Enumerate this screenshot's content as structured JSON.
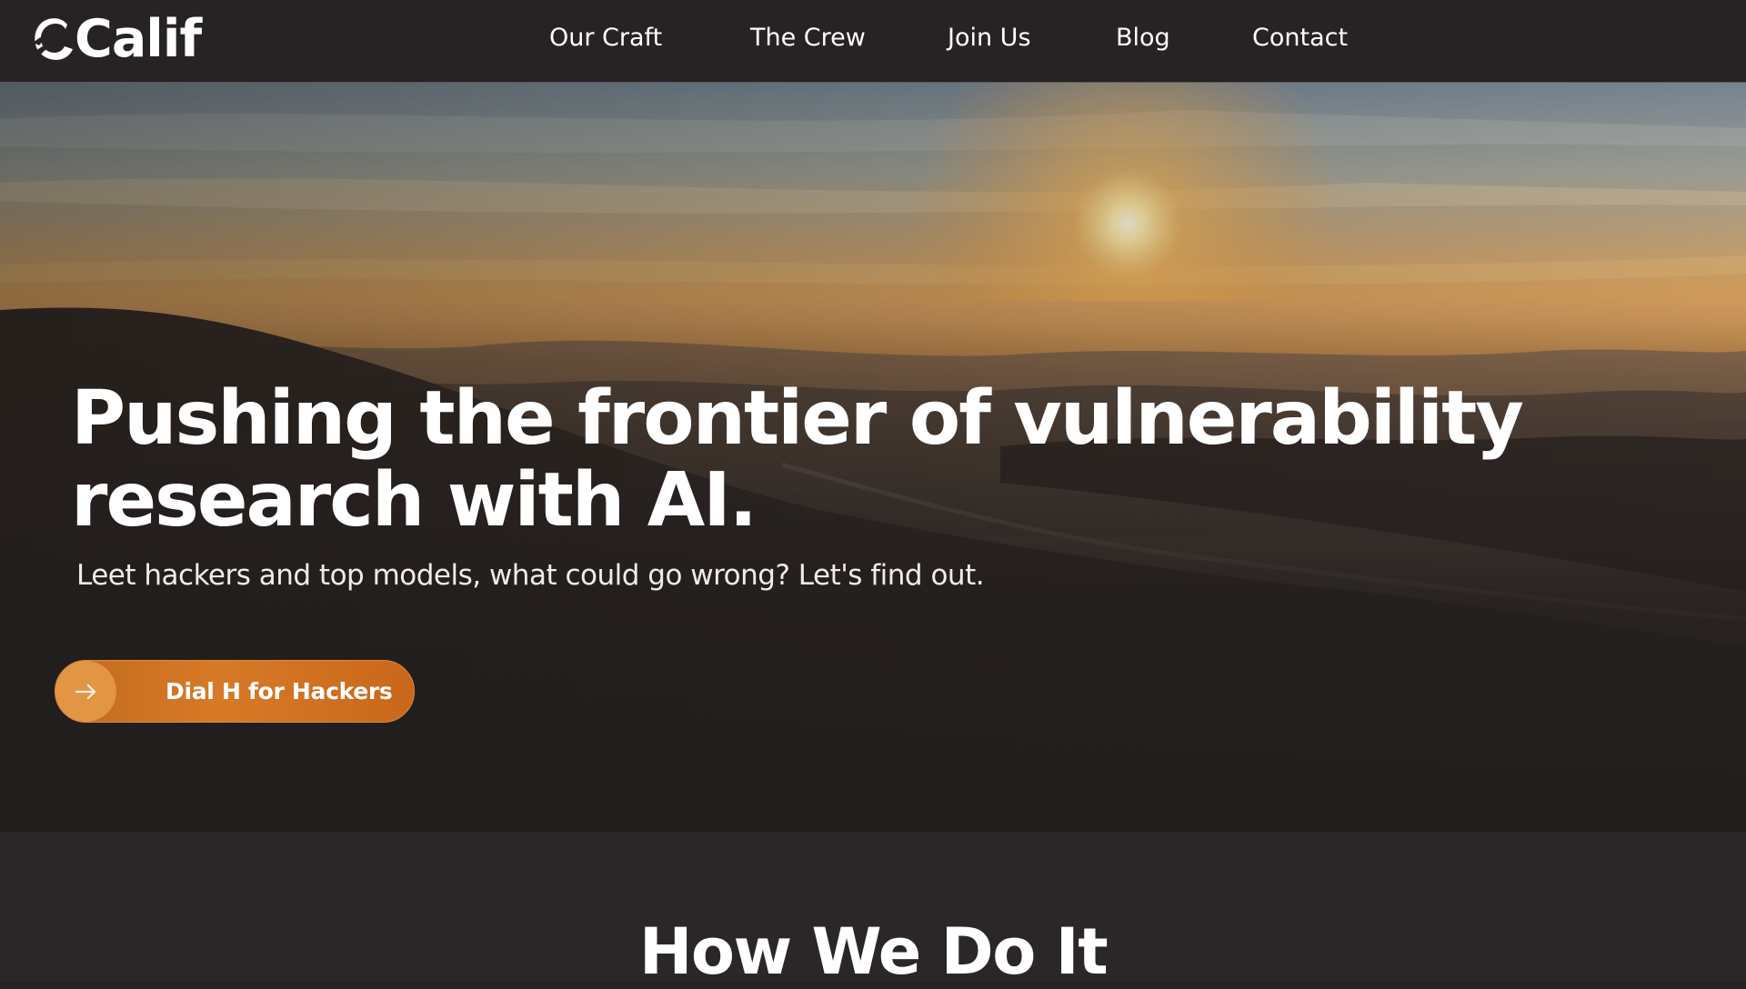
{
  "header": {
    "logo_text": "Calif",
    "nav": {
      "craft": "Our Craft",
      "crew": "The Crew",
      "join": "Join Us",
      "blog": "Blog",
      "contact": "Contact"
    }
  },
  "hero": {
    "title_line1": "Pushing the frontier of vulnerability",
    "title_line2": "research with AI.",
    "subtitle": "Leet hackers and top models, what could go wrong? Let's find out.",
    "cta_label": "Dial H for Hackers",
    "cta_icon": "arrow-right-icon",
    "background": "sunset-over-hills-photo"
  },
  "section": {
    "title": "How We Do It"
  },
  "colors": {
    "header_bg": "#272324",
    "section_bg": "#2b2728",
    "accent_orange": "#d77a27",
    "text": "#ffffff"
  }
}
